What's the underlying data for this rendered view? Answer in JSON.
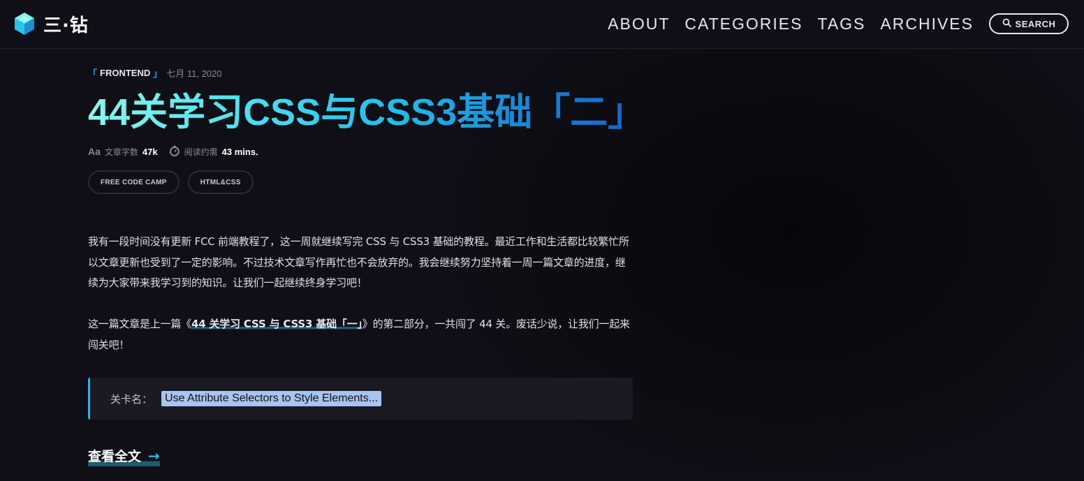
{
  "header": {
    "site_name": "三·钻",
    "nav": [
      {
        "label": "ABOUT"
      },
      {
        "label": "CATEGORIES"
      },
      {
        "label": "TAGS"
      },
      {
        "label": "ARCHIVES"
      }
    ],
    "search_label": "SEARCH"
  },
  "post": {
    "category_open": "「",
    "category": "FRONTEND",
    "category_close": "」",
    "date": "七月 11, 2020",
    "title": "44关学习CSS与CSS3基础「二」",
    "stats": {
      "words_label": "文章字数",
      "words_value": "47k",
      "read_label": "阅读约需",
      "read_value": "43 mins."
    },
    "tags": [
      "FREE CODE CAMP",
      "HTML&CSS"
    ],
    "paragraph1": "我有一段时间没有更新 FCC 前端教程了，这一周就继续写完 CSS 与 CSS3 基础的教程。最近工作和生活都比较繁忙所以文章更新也受到了一定的影响。不过技术文章写作再忙也不会放弃的。我会继续努力坚持着一周一篇文章的进度，继续为大家带来我学习到的知识。让我们一起继续终身学习吧！",
    "paragraph2_before": "这一篇文章是上一篇《",
    "paragraph2_link": "44 关学习 CSS 与 CSS3 基础「一」",
    "paragraph2_after": "》的第二部分，一共闯了 44 关。废话少说，让我们一起来闯关吧！",
    "quote_label": "关卡名：",
    "quote_code": "Use Attribute Selectors to Style Elements...",
    "read_more": "查看全文",
    "read_more_arrow": "→"
  },
  "colors": {
    "background": "#100f17",
    "accent_blue": "#2fb4e6",
    "title_gradient_start": "#8cf7ea",
    "title_gradient_end": "#1565c8",
    "code_highlight": "#a9c4ee"
  },
  "icons": {
    "logo": "cube-logo-icon",
    "search": "search-icon",
    "words": "font-aa-icon",
    "read_time": "stopwatch-icon"
  }
}
